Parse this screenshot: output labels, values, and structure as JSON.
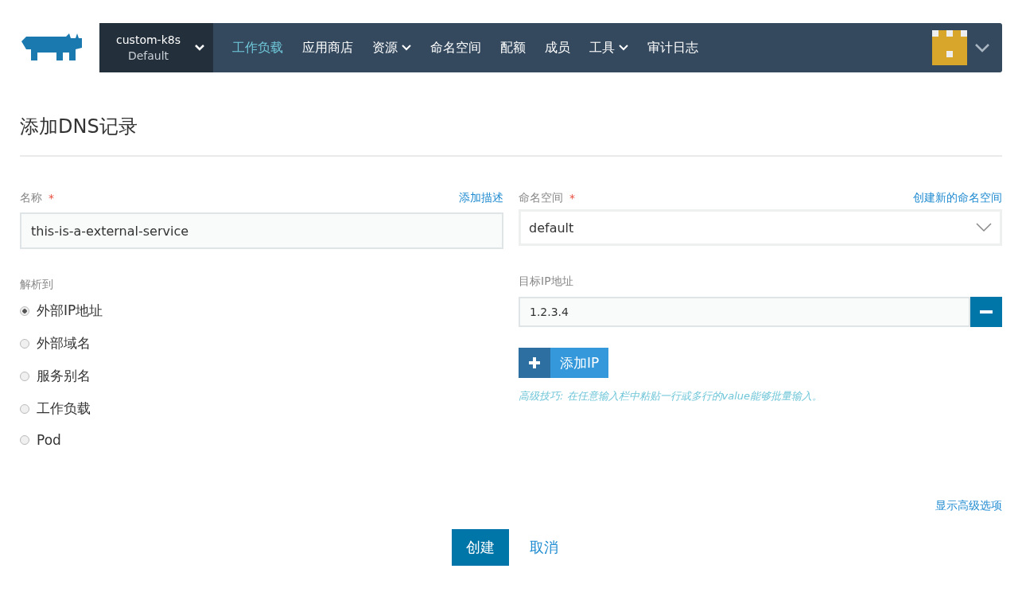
{
  "header": {
    "cluster": {
      "name": "custom-k8s",
      "project": "Default"
    },
    "nav": [
      {
        "label": "工作负载",
        "selected": true,
        "has_menu": false
      },
      {
        "label": "应用商店",
        "selected": false,
        "has_menu": false
      },
      {
        "label": "资源",
        "selected": false,
        "has_menu": true
      },
      {
        "label": "命名空间",
        "selected": false,
        "has_menu": false
      },
      {
        "label": "配额",
        "selected": false,
        "has_menu": false
      },
      {
        "label": "成员",
        "selected": false,
        "has_menu": false
      },
      {
        "label": "工具",
        "selected": false,
        "has_menu": true
      },
      {
        "label": "审计日志",
        "selected": false,
        "has_menu": false
      }
    ]
  },
  "page_title": "添加DNS记录",
  "name_field": {
    "label": "名称",
    "required_mark": "*",
    "link": "添加描述",
    "value": "this-is-a-external-service"
  },
  "namespace_field": {
    "label": "命名空间",
    "required_mark": "*",
    "link": "创建新的命名空间",
    "value": "default"
  },
  "resolve_to": {
    "label": "解析到",
    "options": [
      {
        "label": "外部IP地址",
        "selected": true
      },
      {
        "label": "外部域名",
        "selected": false
      },
      {
        "label": "服务别名",
        "selected": false
      },
      {
        "label": "工作负载",
        "selected": false
      },
      {
        "label": "Pod",
        "selected": false
      }
    ]
  },
  "target_ips": {
    "label": "目标IP地址",
    "values": [
      "1.2.3.4"
    ],
    "add_button": "添加IP",
    "tip": "高级技巧: 在任意输入栏中粘贴一行或多行的value能够批量输入。"
  },
  "advanced_link": "显示高级选项",
  "buttons": {
    "create": "创建",
    "cancel": "取消"
  }
}
